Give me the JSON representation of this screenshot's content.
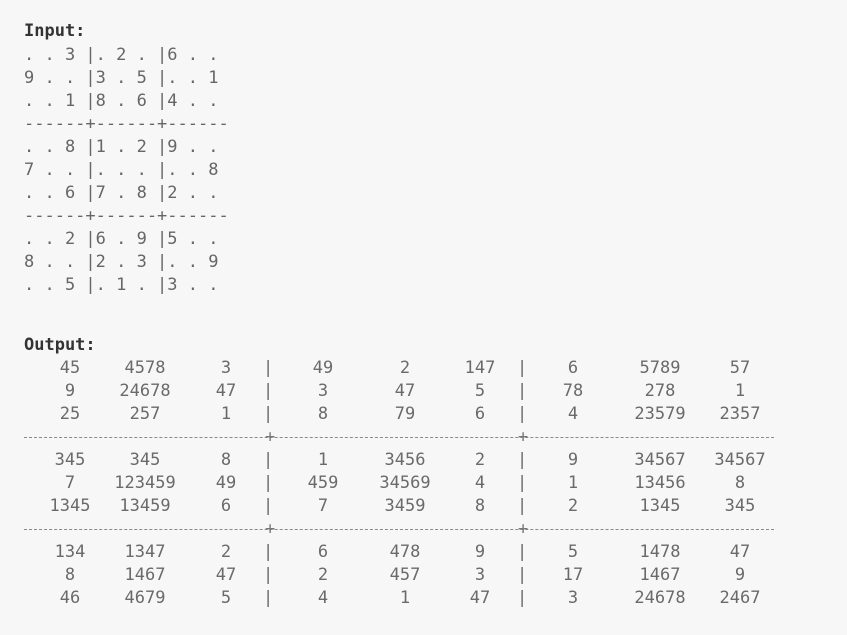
{
  "input": {
    "heading": "Input:",
    "lines": [
      ". . 3 |. 2 . |6 . .",
      "9 . . |3 . 5 |. . 1",
      ". . 1 |8 . 6 |4 . .",
      "------+------+------",
      ". . 8 |1 . 2 |9 . .",
      "7 . . |. . . |. . 8",
      ". . 6 |7 . 8 |2 . .",
      "------+------+------",
      ". . 2 |6 . 9 |5 . .",
      "8 . . |2 . 3 |. . 9",
      ". . 5 |. 1 . |3 . ."
    ]
  },
  "output": {
    "heading": "Output:",
    "bands": [
      [
        [
          "45",
          "4578",
          "3",
          "49",
          "2",
          "147",
          "6",
          "5789",
          "57"
        ],
        [
          "9",
          "24678",
          "47",
          "3",
          "47",
          "5",
          "78",
          "278",
          "1"
        ],
        [
          "25",
          "257",
          "1",
          "8",
          "79",
          "6",
          "4",
          "23579",
          "2357"
        ]
      ],
      [
        [
          "345",
          "345",
          "8",
          "1",
          "3456",
          "2",
          "9",
          "34567",
          "34567"
        ],
        [
          "7",
          "123459",
          "49",
          "459",
          "34569",
          "4",
          "1",
          "13456",
          "8"
        ],
        [
          "1345",
          "13459",
          "6",
          "7",
          "3459",
          "8",
          "2",
          "1345",
          "345"
        ]
      ],
      [
        [
          "134",
          "1347",
          "2",
          "6",
          "478",
          "9",
          "5",
          "1478",
          "47"
        ],
        [
          "8",
          "1467",
          "47",
          "2",
          "457",
          "3",
          "17",
          "1467",
          "9"
        ],
        [
          "46",
          "4679",
          "5",
          "4",
          "1",
          "47",
          "3",
          "24678",
          "2467"
        ]
      ]
    ],
    "column_bar": "|",
    "separator_plus": "+"
  }
}
